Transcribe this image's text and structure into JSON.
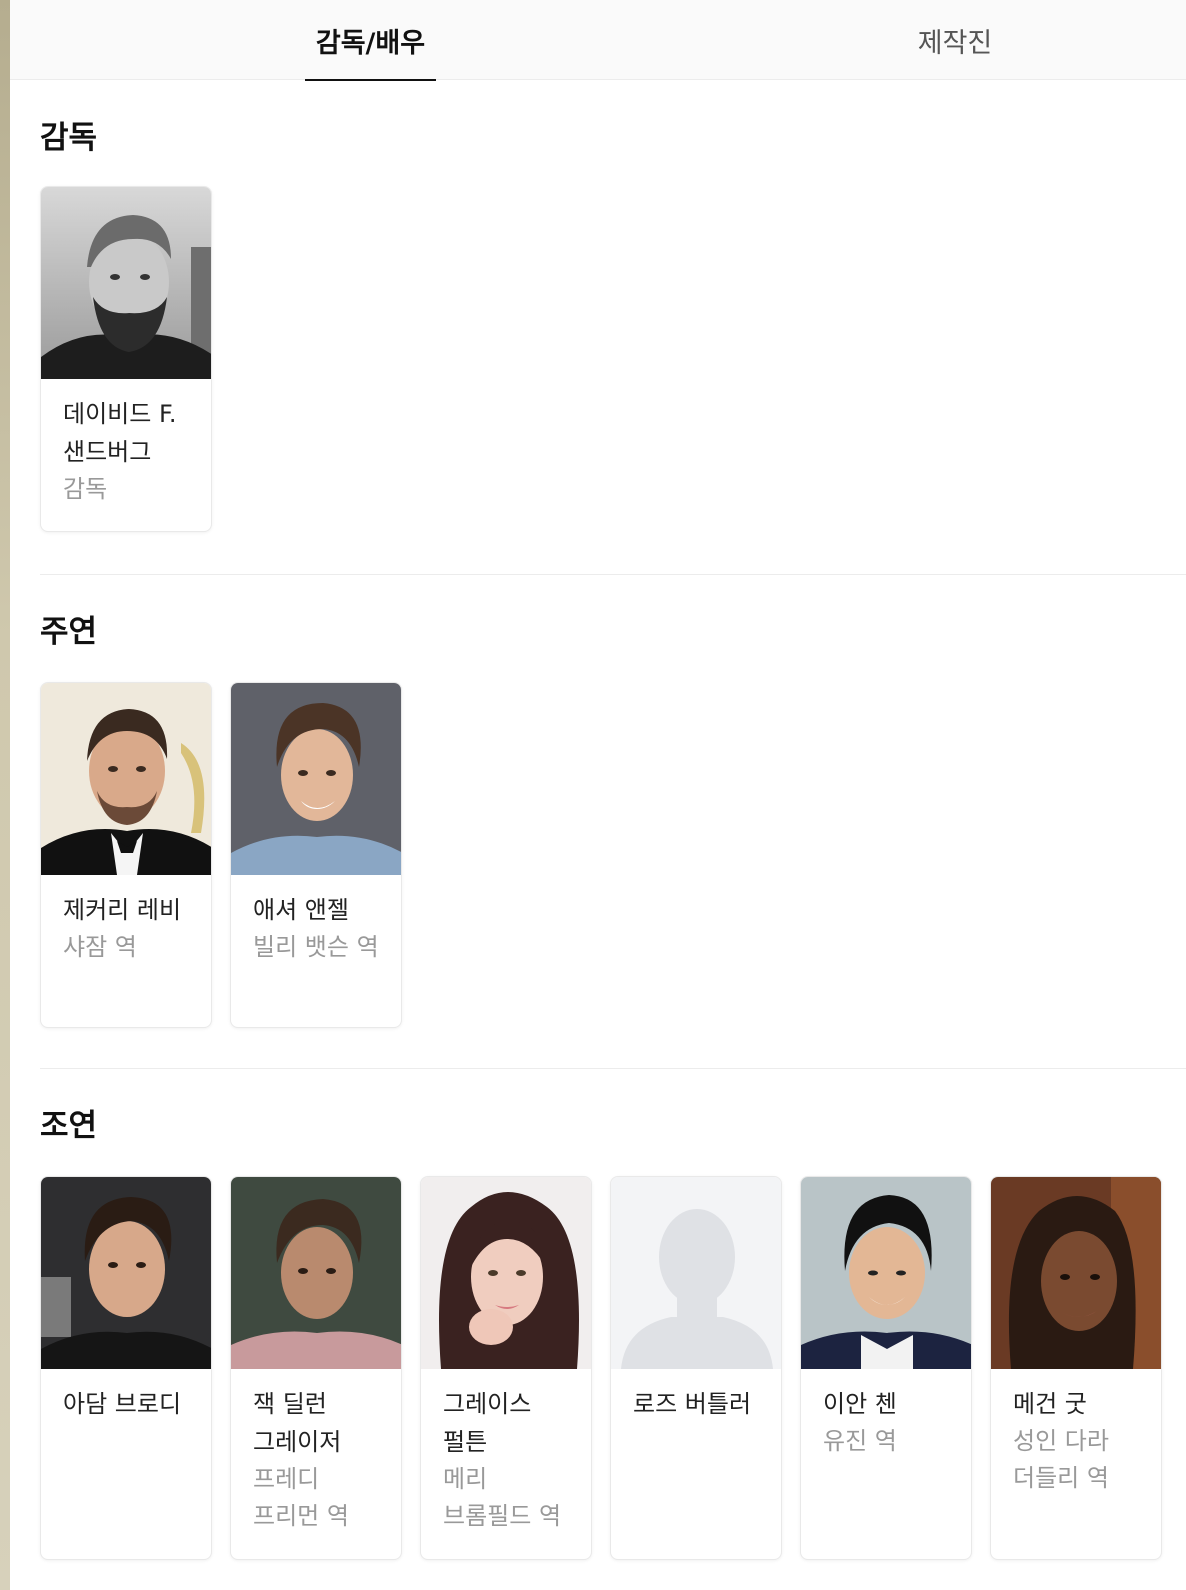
{
  "tabs": [
    {
      "label": "감독/배우",
      "active": true
    },
    {
      "label": "제작진",
      "active": false
    }
  ],
  "sections": {
    "director": {
      "title": "감독",
      "people": [
        {
          "name": "데이비드 F. 샌드버그",
          "role": "감독",
          "photo": "photo-david-sandberg"
        }
      ]
    },
    "lead": {
      "title": "주연",
      "people": [
        {
          "name": "제커리 레비",
          "role": "샤잠 역",
          "photo": "photo-zachary-levi"
        },
        {
          "name": "애셔 앤젤",
          "role": "빌리 뱃슨 역",
          "photo": "photo-asher-angel"
        }
      ]
    },
    "supporting": {
      "title": "조연",
      "people": [
        {
          "name": "아담 브로디",
          "role": "",
          "photo": "photo-adam-brody"
        },
        {
          "name": "잭 딜런 그레이저",
          "role": "프레디 프리먼 역",
          "photo": "photo-jack-dylan-grazer"
        },
        {
          "name": "그레이스 펄튼",
          "role": "메리 브롬필드 역",
          "photo": "photo-grace-fulton"
        },
        {
          "name": "로즈 버틀러",
          "role": "",
          "photo": "placeholder-silhouette-icon"
        },
        {
          "name": "이안 첸",
          "role": "유진 역",
          "photo": "photo-ian-chen"
        },
        {
          "name": "메건 굿",
          "role": "성인 다라 더들리 역",
          "photo": "photo-meagan-good"
        }
      ]
    }
  },
  "colors": {
    "active_tab_underline": "#111111",
    "role_text": "#999999",
    "placeholder_bg": "#f3f4f6",
    "placeholder_silhouette": "#dfe1e5"
  }
}
